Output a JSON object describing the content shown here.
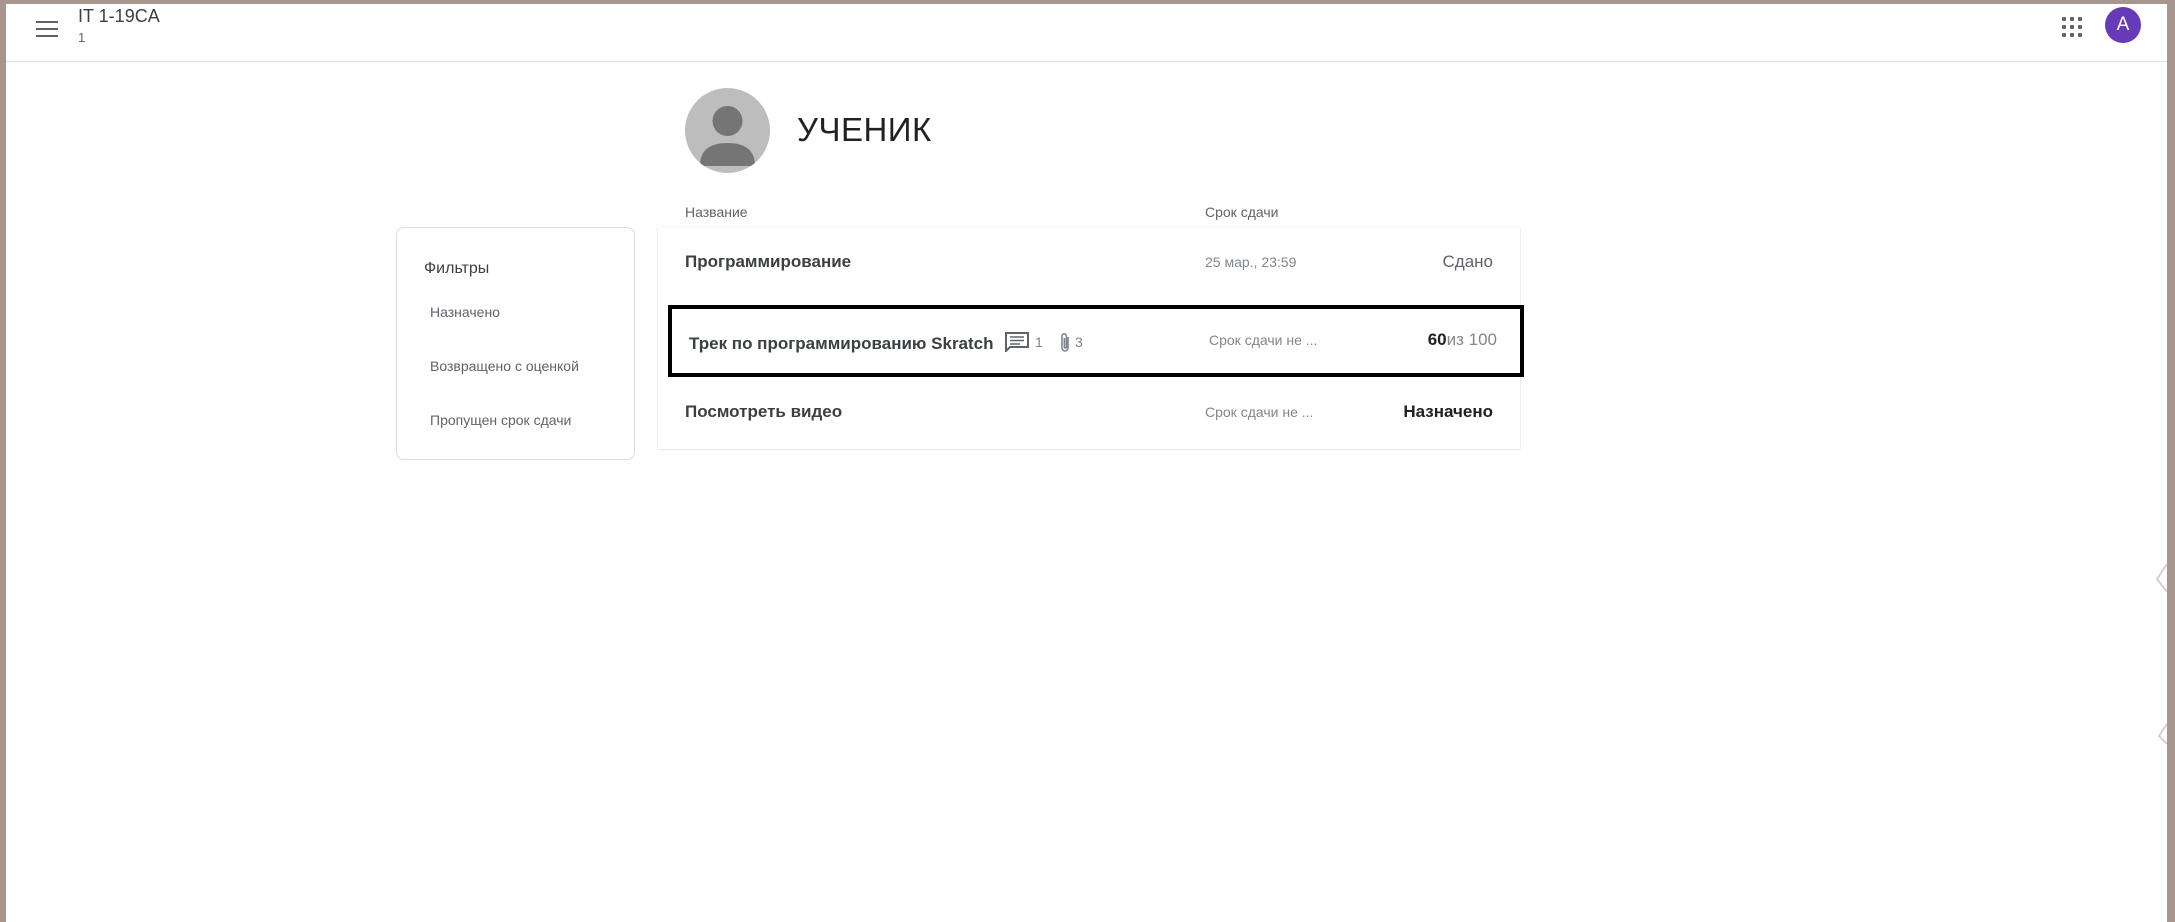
{
  "header": {
    "class_title": "IT 1-19CA",
    "class_subtitle": "1",
    "account_initial": "A"
  },
  "student": {
    "name": "УЧЕНИК"
  },
  "columns": {
    "name": "Название",
    "due": "Срок сдачи"
  },
  "filters": {
    "title": "Фильтры",
    "items": [
      "Назначено",
      "Возвращено с оценкой",
      "Пропущен срок сдачи"
    ]
  },
  "assignments": [
    {
      "name": "Программирование",
      "due": "25 мар., 23:59",
      "status": "Сдано"
    },
    {
      "name": "Трек по программированию Skratch",
      "comments": "1",
      "attachments": "3",
      "due": "Срок сдачи не ...",
      "grade": "60",
      "grade_suffix": "из 100"
    },
    {
      "name": "Посмотреть видео",
      "due": "Срок сдачи не ...",
      "status": "Назначено"
    }
  ],
  "colors": {
    "accent_avatar": "#673ab7",
    "highlight_border": "#000000",
    "background_frame": "#a8958d"
  },
  "icons": [
    "menu-icon",
    "apps-icon",
    "student-avatar-icon",
    "comment-icon",
    "attachment-icon"
  ]
}
